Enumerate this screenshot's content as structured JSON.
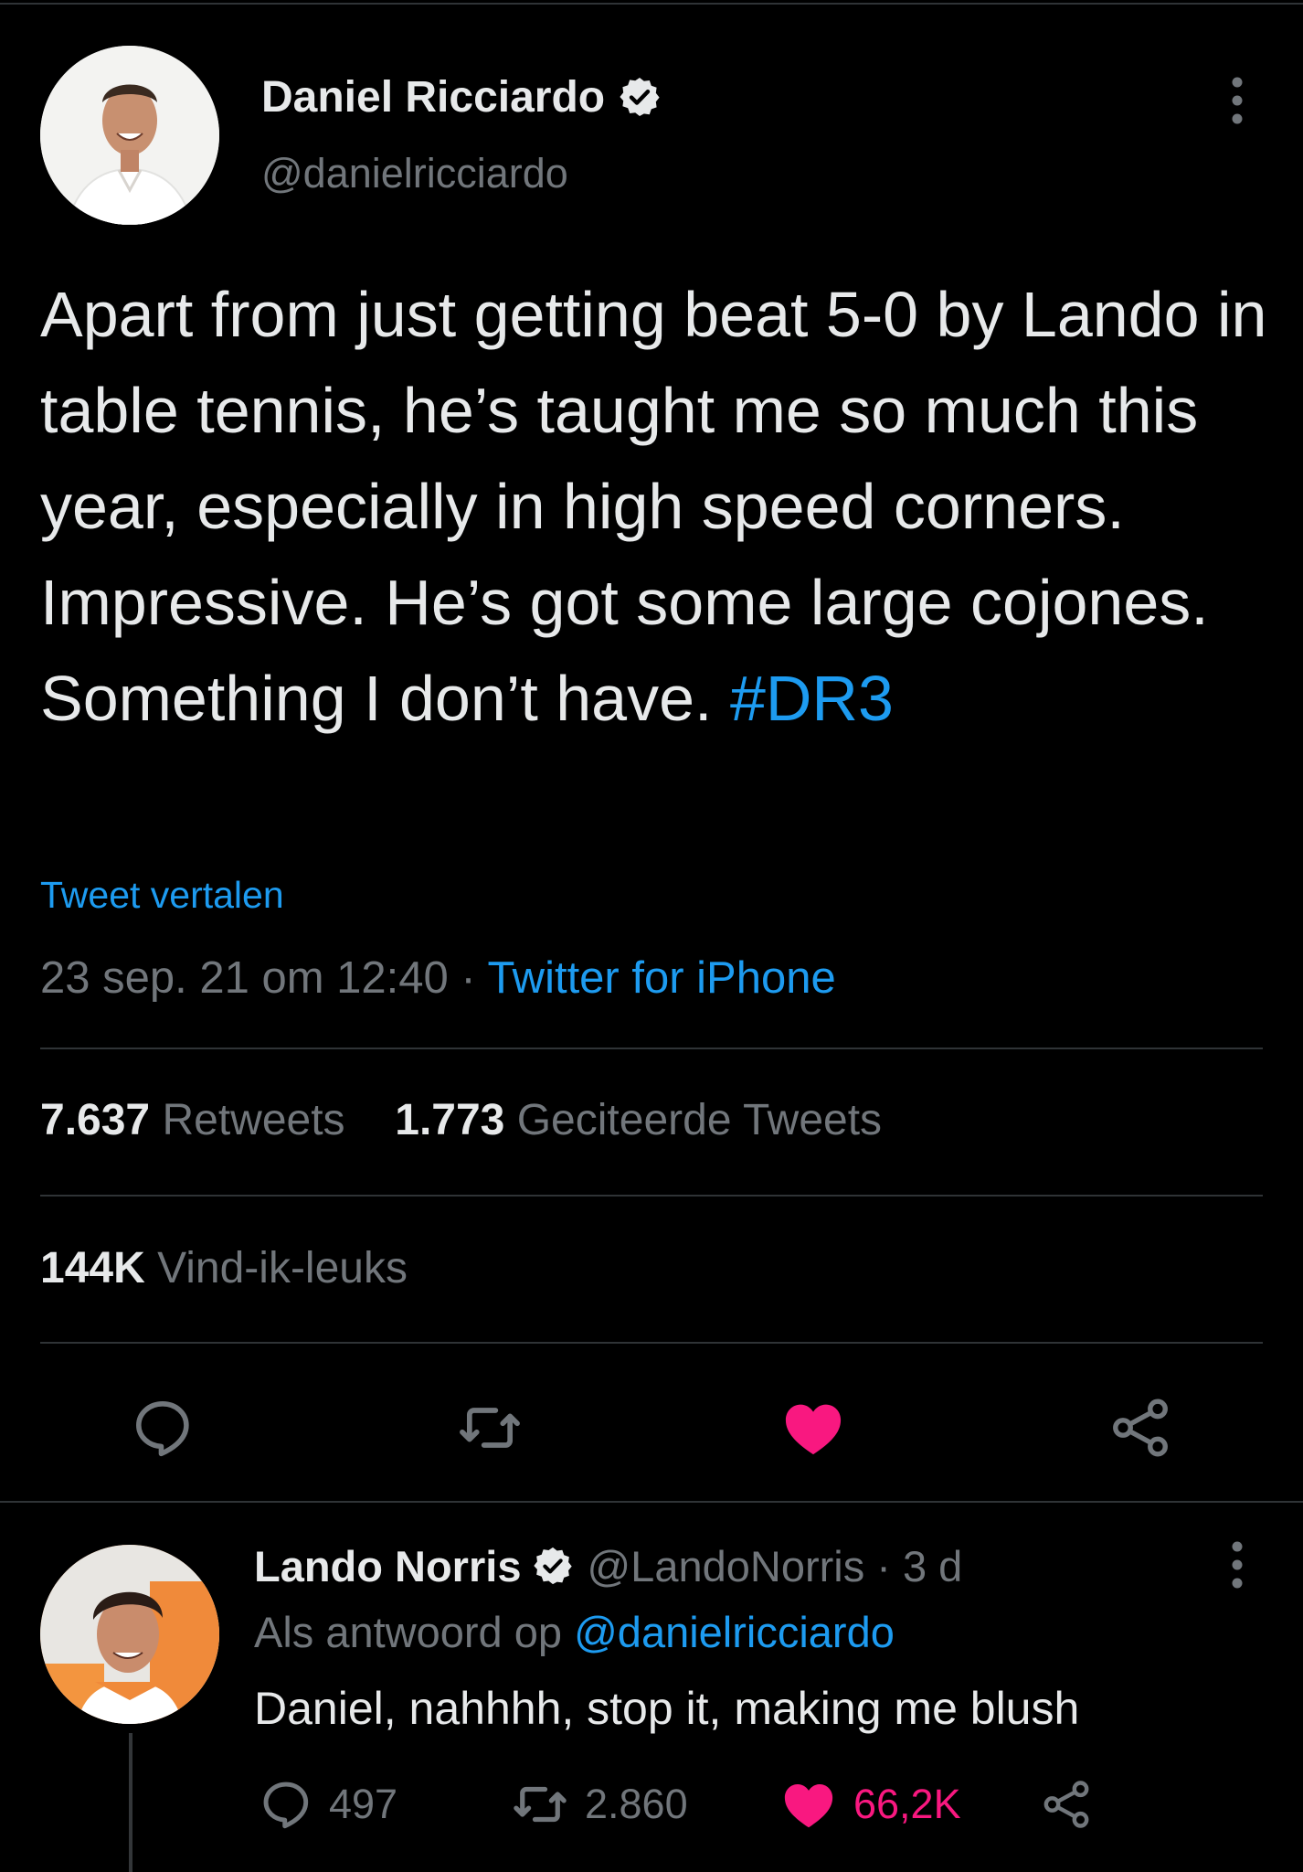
{
  "tweet": {
    "author_name": "Daniel Ricciardo",
    "author_handle": "@danielricciardo",
    "text_main": "Apart from just getting beat 5-0 by Lando in table tennis, he’s taught me so much this year, especially in high speed corners. Impressive. He’s got some large cojones. Something I don’t have. ",
    "hashtag": "#DR3",
    "translate_label": "Tweet vertalen",
    "timestamp": "23 sep. 21 om 12:40",
    "separator": " · ",
    "source": "Twitter for iPhone",
    "retweets_count": "7.637",
    "retweets_label": "Retweets",
    "quotes_count": "1.773",
    "quotes_label": "Geciteerde Tweets",
    "likes_count": "144K",
    "likes_label": "Vind-ik-leuks"
  },
  "actions": [
    "reply-icon",
    "retweet-icon",
    "heart-icon",
    "share-icon"
  ],
  "reply": {
    "author_name": "Lando Norris",
    "handle_time": "@LandoNorris · 3 d",
    "reply_to_label": "Als antwoord op ",
    "reply_to_mention": "@danielricciardo",
    "text": "Daniel, nahhhh, stop it, making me blush",
    "reply_count": "497",
    "retweet_count": "2.860",
    "like_count": "66,2K"
  },
  "colors": {
    "background": "#000000",
    "text": "#e7e9ea",
    "secondary": "#71767b",
    "link": "#1d9bf0",
    "like": "#f91880",
    "divider": "#2f3336"
  }
}
